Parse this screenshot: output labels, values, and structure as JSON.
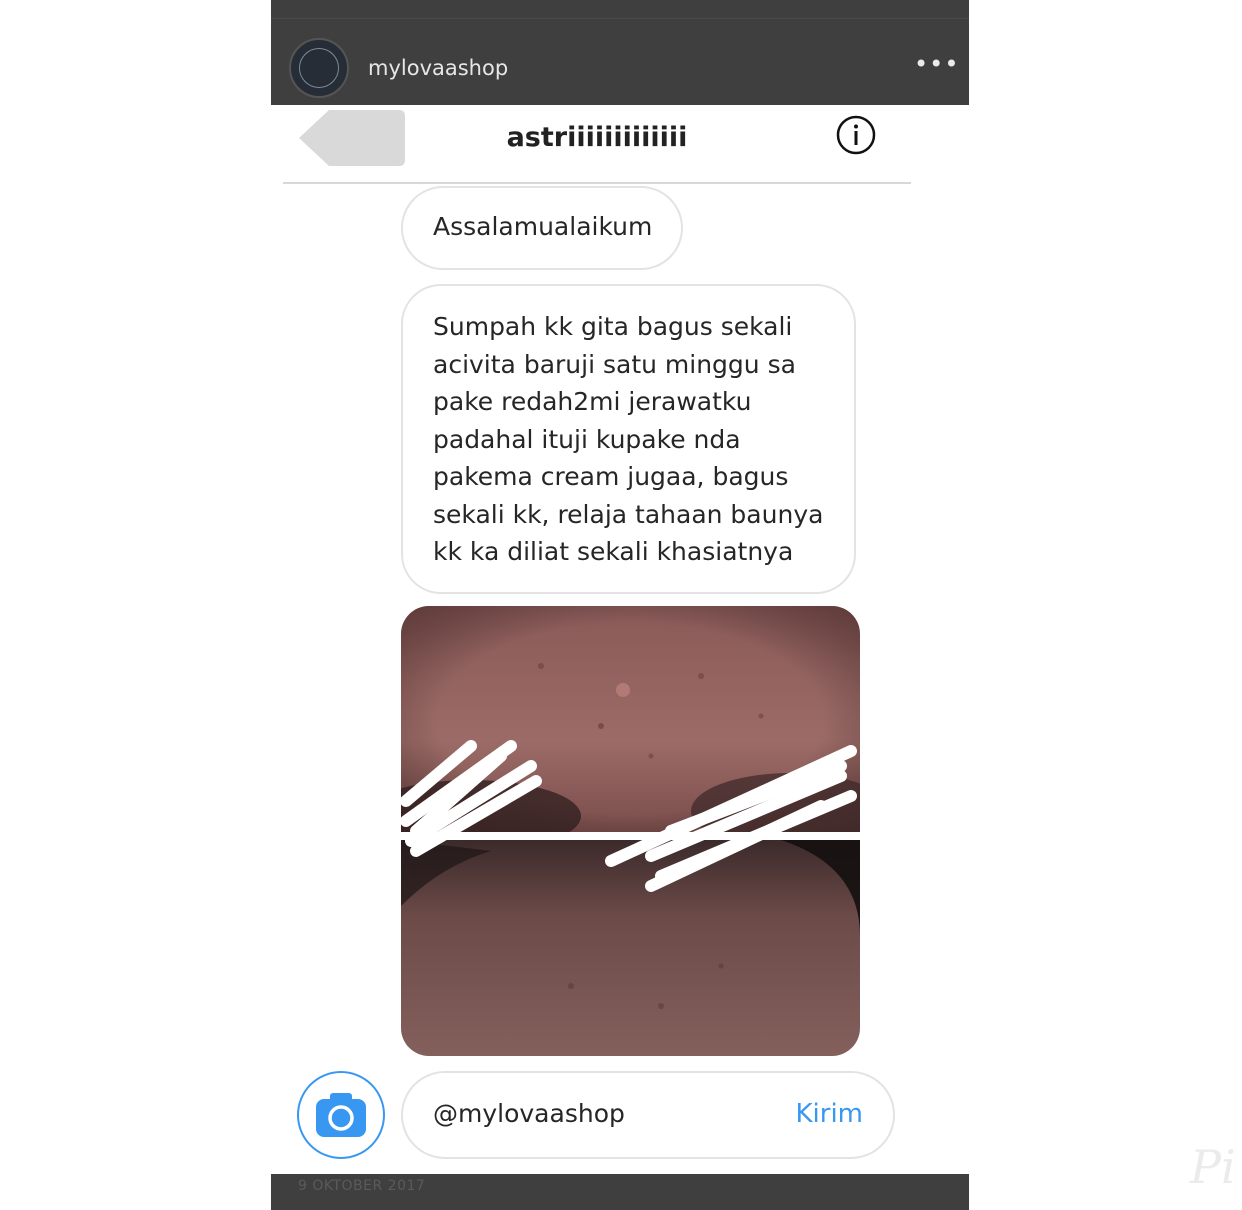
{
  "header": {
    "username": "mylovaashop",
    "more_icon": "more-horizontal-icon"
  },
  "conversation": {
    "title": "astriiiiiiiiiiiii",
    "back_icon": "back-arrow-icon",
    "info_icon": "info-circle-icon"
  },
  "messages": [
    {
      "text": "Assalamualaikum"
    },
    {
      "lines": [
        "Sumpah kk gita bagus sekali",
        "acivita baruji satu minggu sa",
        "pake redah2mi jerawatku",
        "padahal ituji kupake nda",
        "pakema cream jugaa, bagus",
        "sekali kk, relaja tahaan baunya",
        "kk ka diliat sekali khasiatnya"
      ]
    }
  ],
  "composer": {
    "camera_icon": "camera-icon",
    "input_value": "@mylovaashop",
    "send_label": "Kirim"
  },
  "footer": {
    "date": "9 OKTOBER 2017"
  },
  "watermark": "Pi",
  "colors": {
    "accent": "#3897f0",
    "header_bg": "#3f3f3f"
  }
}
